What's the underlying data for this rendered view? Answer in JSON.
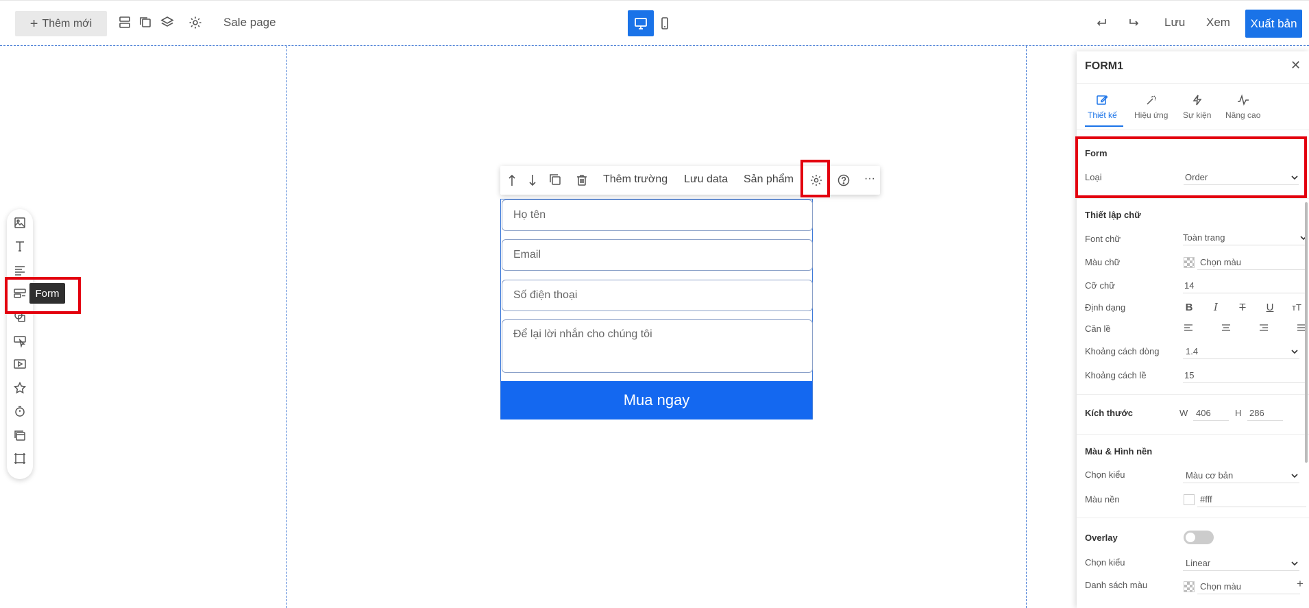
{
  "topbar": {
    "add_label": "Thêm mới",
    "page_name": "Sale page",
    "save_label": "Lưu",
    "preview_label": "Xem",
    "publish_label": "Xuất bản"
  },
  "leftbar": {
    "tooltip": "Form",
    "tools": [
      "image-icon",
      "text-icon",
      "paragraph-icon",
      "form-icon",
      "shape-icon",
      "button-icon",
      "video-icon",
      "star-icon",
      "timer-icon",
      "gallery-icon",
      "frame-icon"
    ]
  },
  "element_toolbar": {
    "add_field": "Thêm trường",
    "save_data": "Lưu data",
    "product": "Sản phẩm",
    "more": "···"
  },
  "form": {
    "fields": [
      {
        "placeholder": "Họ tên"
      },
      {
        "placeholder": "Email"
      },
      {
        "placeholder": "Số điện thoại"
      },
      {
        "placeholder": "Để lại lời nhắn cho chúng tôi"
      }
    ],
    "button_label": "Mua ngay"
  },
  "panel": {
    "title": "FORM1",
    "tabs": [
      {
        "label": "Thiết kế",
        "icon": "edit-icon",
        "active": true
      },
      {
        "label": "Hiệu ứng",
        "icon": "magic-icon",
        "active": false
      },
      {
        "label": "Sự kiện",
        "icon": "lightning-icon",
        "active": false
      },
      {
        "label": "Nâng cao",
        "icon": "advanced-icon",
        "active": false
      }
    ],
    "form_section": {
      "title": "Form",
      "type_label": "Loại",
      "type_value": "Order"
    },
    "text_section": {
      "title": "Thiết lập chữ",
      "font_label": "Font chữ",
      "font_value": "Toàn trang",
      "color_label": "Màu chữ",
      "color_value": "Chọn màu",
      "size_label": "Cỡ chữ",
      "size_value": "14",
      "format_label": "Định dạng",
      "align_label": "Căn lề",
      "line_height_label": "Khoảng cách dòng",
      "line_height_value": "1.4",
      "padding_label": "Khoảng cách lề",
      "padding_value": "15"
    },
    "size_section": {
      "title": "Kích thước",
      "w_label": "W",
      "w_value": "406",
      "h_label": "H",
      "h_value": "286"
    },
    "bg_section": {
      "title": "Màu & Hình nền",
      "style_label": "Chọn kiểu",
      "style_value": "Màu cơ bản",
      "bg_label": "Màu nền",
      "bg_value": "#fff"
    },
    "overlay_section": {
      "title": "Overlay",
      "enabled": false,
      "style_label": "Chọn kiểu",
      "style_value": "Linear",
      "colors_label": "Danh sách màu",
      "colors_value": "Chọn màu"
    }
  },
  "colors": {
    "accent": "#1a73e8",
    "highlight": "#e3000f",
    "button": "#1468f0"
  }
}
